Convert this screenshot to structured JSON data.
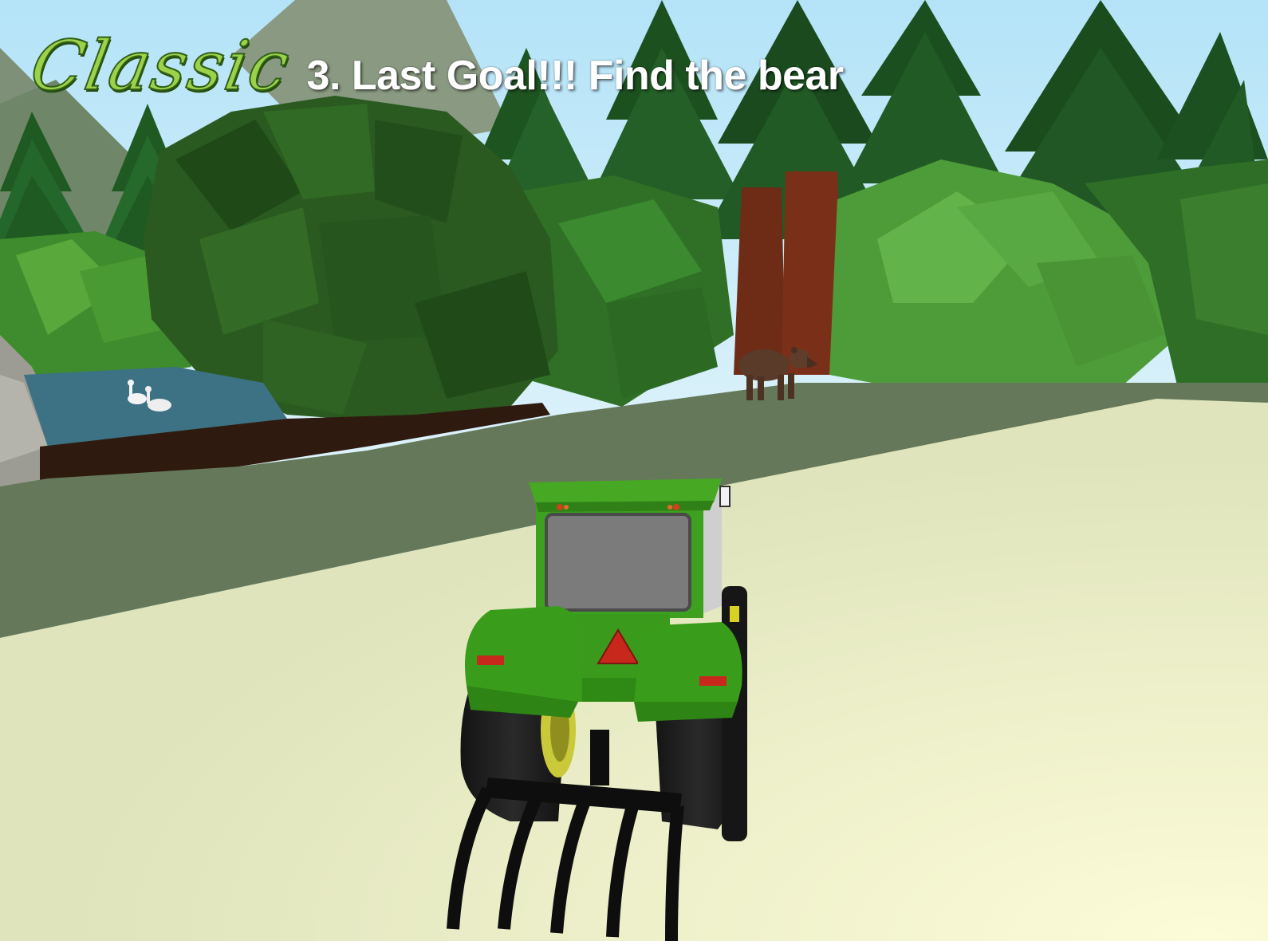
{
  "hud": {
    "mode_logo": "Classic",
    "goal_text": "3. Last Goal!!! Find the bear"
  },
  "scene": {
    "player_vehicle": "green tractor with rear fork",
    "target": "bear",
    "colors": {
      "sky": "#b8e4f7",
      "tractor_green": "#3c9a1c",
      "ground_light": "#e6ebc4",
      "grass_path": "#65795a",
      "water": "#3c7284",
      "bear": "#5a3a28"
    }
  }
}
